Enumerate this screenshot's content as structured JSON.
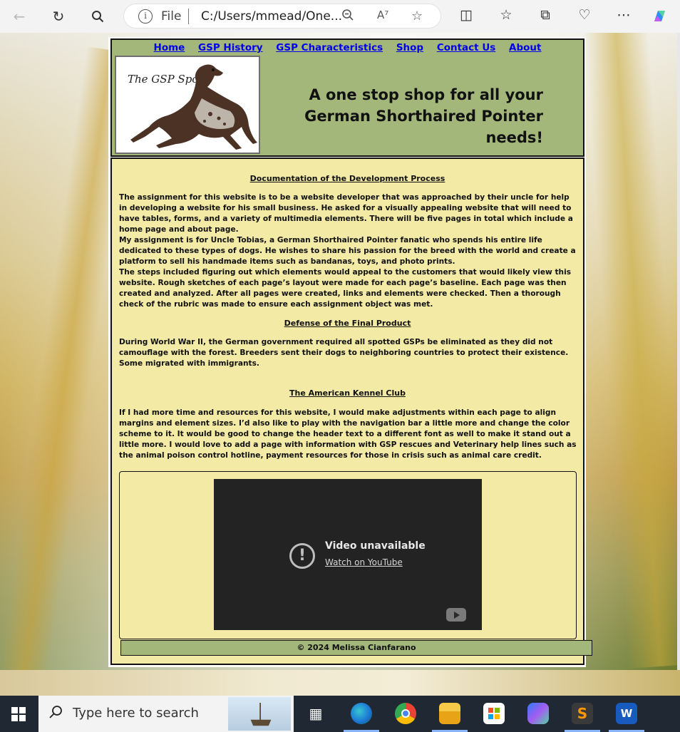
{
  "browser": {
    "address_prefix": "File",
    "address_url": "C:/Users/mmead/One..."
  },
  "nav": {
    "links": [
      "Home",
      "GSP History",
      "GSP Characteristics",
      "Shop",
      "Contact Us",
      "About"
    ]
  },
  "header": {
    "logo_text": "The GSP Spot",
    "tagline_line1": "A one stop shop for all your",
    "tagline_line2": "German Shorthaired Pointer needs!"
  },
  "sections": [
    {
      "title": "Documentation of the Development Process",
      "text": "The assignment for this website is to be a website developer that was approached by their uncle for help in developing a website for his small business. He asked for a visually appealing website that will need to have tables, forms, and a variety of multimedia elements. There will be five pages in total which include a home page and about page.\nMy assignment is for Uncle Tobias, a German Shorthaired Pointer fanatic who spends his entire life dedicated to these types of dogs. He wishes to share his passion for the breed with the world and create a platform to sell his handmade items such as bandanas, toys, and photo prints.\nThe steps included figuring out which elements would appeal to the customers that would likely view this website. Rough sketches of each page’s layout were made for each page’s baseline. Each page was then created and analyzed. After all pages were created, links and elements were checked. Then a thorough check of the rubric was made to ensure each assignment object was met."
    },
    {
      "title": "Defense of the Final Product",
      "text": "During World War II, the German government required all spotted GSPs be eliminated as they did not camouflage with the forest. Breeders sent their dogs to neighboring countries to protect their existence. Some migrated with immigrants."
    },
    {
      "title": "The American Kennel Club",
      "text": "If I had more time and resources for this website, I would make adjustments within each page to align margins and element sizes. I’d also like to play with the navigation bar a little more and change the color scheme to it. It would be good to change the header text to a different font as well to make it stand out a little more. I would love to add a page with information with GSP rescues and Veterinary help lines such as the animal poison control hotline, payment resources for those in crisis such as animal care credit."
    }
  ],
  "video": {
    "status": "Video unavailable",
    "link": "Watch on YouTube"
  },
  "footer": {
    "text": "© 2024 Melissa Cianfarano"
  },
  "taskbar": {
    "search_placeholder": "Type here to search"
  },
  "colors": {
    "header_bg": "#a4b77b",
    "content_bg": "#f3eaa5",
    "link": "#0000ee",
    "taskbar": "#1f2833"
  },
  "icons": [
    "back-icon",
    "refresh-icon",
    "search-icon",
    "info-icon",
    "zoom-out-icon",
    "read-aloud-icon",
    "favorite-star-icon",
    "split-screen-icon",
    "favorites-icon",
    "collections-icon",
    "browser-essentials-icon",
    "more-icon",
    "copilot-icon",
    "windows-start-icon",
    "task-view-icon",
    "edge-icon",
    "chrome-icon",
    "file-explorer-icon",
    "store-icon",
    "copilot-app-icon",
    "sublime-icon",
    "word-icon"
  ]
}
